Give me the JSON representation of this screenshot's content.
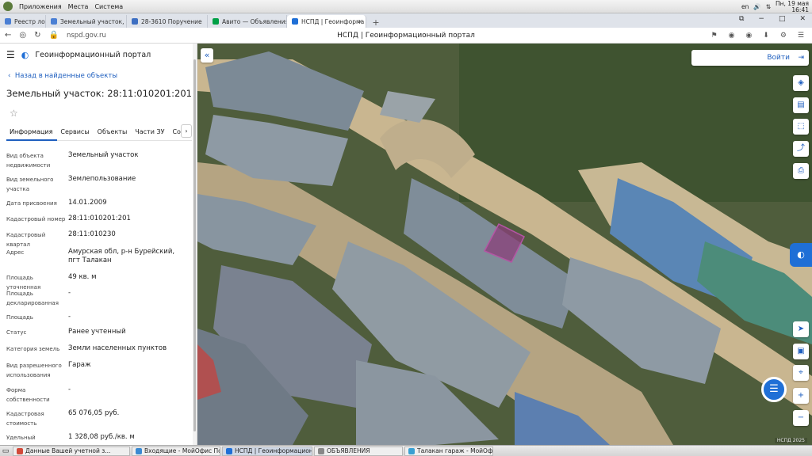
{
  "os": {
    "menu": [
      "Приложения",
      "Места",
      "Система"
    ],
    "lang": "en",
    "clock_day": "Пн, 19 мая",
    "clock_time": "16:41"
  },
  "tabs": [
    {
      "label": "Реестр лотов",
      "color": "#4a7fd4"
    },
    {
      "label": "Земельный участок, п",
      "color": "#4a7fd4"
    },
    {
      "label": "28-3610 Поручение",
      "color": "#3d6fc2"
    },
    {
      "label": "Авито — Объявления",
      "color": "#00a046"
    },
    {
      "label": "НСПД | Геоинформа",
      "color": "#1f6fd6"
    }
  ],
  "browser": {
    "url": "nspd.gov.ru",
    "page_title": "НСПД | Геоинформационный портал"
  },
  "panel": {
    "brand": "Геоинформационный портал",
    "back": "Назад в найденные объекты",
    "title": "Земельный участок: 28:11:010201:201",
    "tabs": [
      "Информация",
      "Сервисы",
      "Объекты",
      "Части ЗУ",
      "Соста"
    ],
    "properties": [
      {
        "k": "Вид объекта недвижимости",
        "v": "Земельный участок"
      },
      {
        "k": "Вид земельного участка",
        "v": "Землепользование"
      },
      {
        "k": "Дата присвоения",
        "v": "14.01.2009"
      },
      {
        "k": "Кадастровый номер",
        "v": "28:11:010201:201"
      },
      {
        "k": "Кадастровый квартал",
        "v": "28:11:010230"
      },
      {
        "k": "Адрес",
        "v": "Амурская обл, р-н Бурейский, пгт Талакан"
      },
      {
        "k": "Площадь уточненная",
        "v": "49 кв. м"
      },
      {
        "k": "Площадь декларированная",
        "v": "-"
      },
      {
        "k": "Площадь",
        "v": "-"
      },
      {
        "k": "Статус",
        "v": "Ранее учтенный"
      },
      {
        "k": "Категория земель",
        "v": "Земли населенных пунктов"
      },
      {
        "k": "Вид разрешенного использования",
        "v": "Гараж"
      },
      {
        "k": "Форма собственности",
        "v": "-"
      },
      {
        "k": "Кадастровая стоимость",
        "v": "65 076,05 руб."
      },
      {
        "k": "Удельный показатель",
        "v": "1 328,08 руб./кв. м"
      }
    ]
  },
  "map": {
    "login": "Войти",
    "copyright": "НСПД 2025"
  },
  "taskbar": [
    {
      "label": "Данные Вашей учетной з...",
      "color": "#d24a3a"
    },
    {
      "label": "Входящие - МойОфис По...",
      "color": "#3a8ad2"
    },
    {
      "label": "НСПД | Геоинформацион...",
      "color": "#1f6fd6"
    },
    {
      "label": "ОБЪЯВЛЕНИЯ",
      "color": "#888888"
    },
    {
      "label": "Талакан гараж - МойОфис",
      "color": "#3aa0d2"
    }
  ]
}
